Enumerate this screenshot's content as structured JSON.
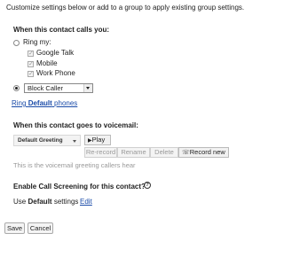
{
  "intro": "Customize settings below or add to a group to apply existing group settings.",
  "calls": {
    "heading": "When this contact calls you:",
    "ring_label": "Ring my:",
    "phones": [
      {
        "label": "Google Talk",
        "checked": true
      },
      {
        "label": "Mobile",
        "checked": true
      },
      {
        "label": "Work Phone",
        "checked": true
      }
    ],
    "action_selected": "Block Caller",
    "ring_default_link_prefix": "Ring",
    "ring_default_link_bold": "Default",
    "ring_default_link_suffix": "phones"
  },
  "voicemail": {
    "heading": "When this contact goes to voicemail:",
    "greeting_selected": "Default Greeting",
    "play": "Play",
    "rerecord": "Re-record",
    "rename": "Rename",
    "delete": "Delete",
    "record_new": "Record new",
    "hint": "This is the voicemail greeting callers hear"
  },
  "screening": {
    "heading": "Enable Call Screening for this contact?",
    "use_prefix": "Use",
    "use_bold": "Default",
    "use_suffix": "settings",
    "edit": "Edit"
  },
  "footer": {
    "save": "Save",
    "cancel": "Cancel"
  }
}
